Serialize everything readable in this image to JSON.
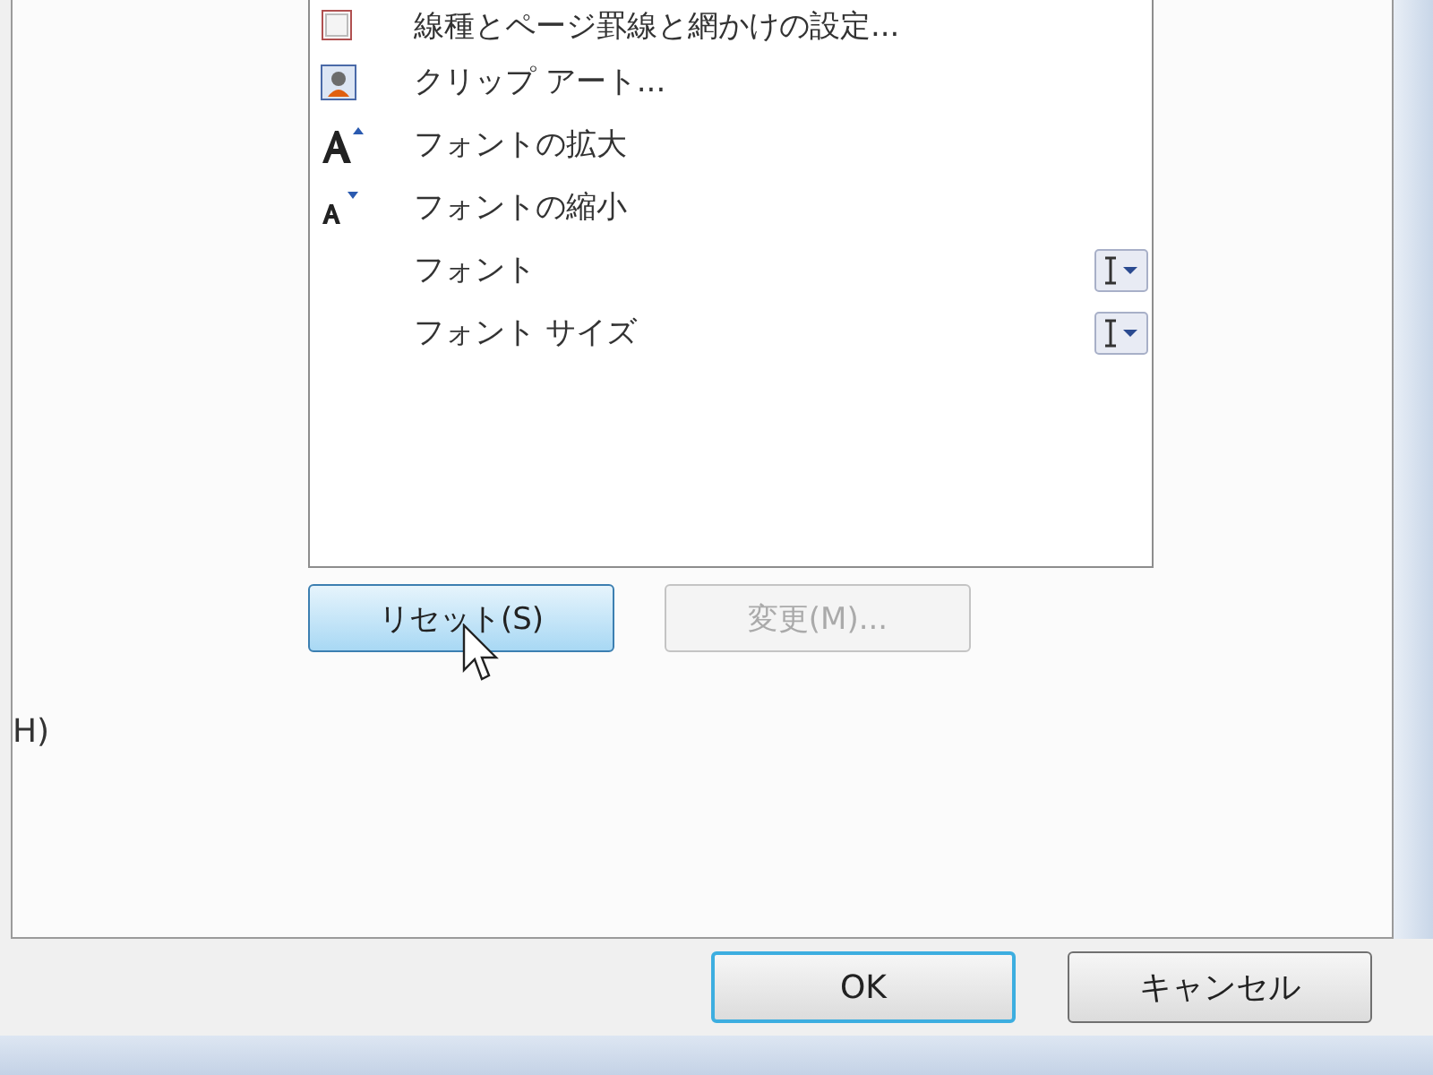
{
  "commands": [
    {
      "label": "線種とページ罫線と網かけの設定...",
      "kind": "border"
    },
    {
      "label": "クリップ アート...",
      "kind": "clipart"
    },
    {
      "label": "フォントの拡大",
      "kind": "grow"
    },
    {
      "label": "フォントの縮小",
      "kind": "shrink"
    },
    {
      "label": "フォント",
      "kind": "combo"
    },
    {
      "label": "フォント サイズ",
      "kind": "combo"
    }
  ],
  "side_label": "H)",
  "list_buttons": [
    {
      "label": "リセット(S)",
      "hovered": true,
      "disabled": false
    },
    {
      "label": "変更(M)...",
      "hovered": false,
      "disabled": true
    }
  ],
  "dialog_buttons": [
    {
      "label": "OK",
      "focused": true
    },
    {
      "label": "キャンセル",
      "focused": false
    }
  ]
}
